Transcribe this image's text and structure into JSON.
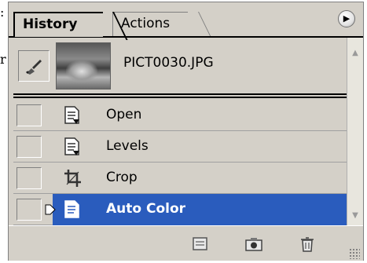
{
  "tabs": [
    {
      "label": "History",
      "active": true
    },
    {
      "label": "Actions",
      "active": false
    }
  ],
  "panel_menu_icon": "triangle-right-icon",
  "snapshot": {
    "name": "PICT0030.JPG",
    "brush_icon": "history-brush-icon"
  },
  "history_states": [
    {
      "label": "Open",
      "icon": "document-state-icon",
      "selected": false
    },
    {
      "label": "Levels",
      "icon": "document-state-icon",
      "selected": false
    },
    {
      "label": "Crop",
      "icon": "crop-icon",
      "selected": false
    },
    {
      "label": "Auto Color",
      "icon": "document-state-icon",
      "selected": true
    }
  ],
  "footer_buttons": [
    {
      "icon": "new-document-from-state-icon"
    },
    {
      "icon": "new-snapshot-icon"
    },
    {
      "icon": "trash-icon"
    }
  ],
  "colors": {
    "panel_bg": "#d4d0c8",
    "selection": "#2a5cbd"
  },
  "page_edge_text": [
    ":",
    "r"
  ]
}
